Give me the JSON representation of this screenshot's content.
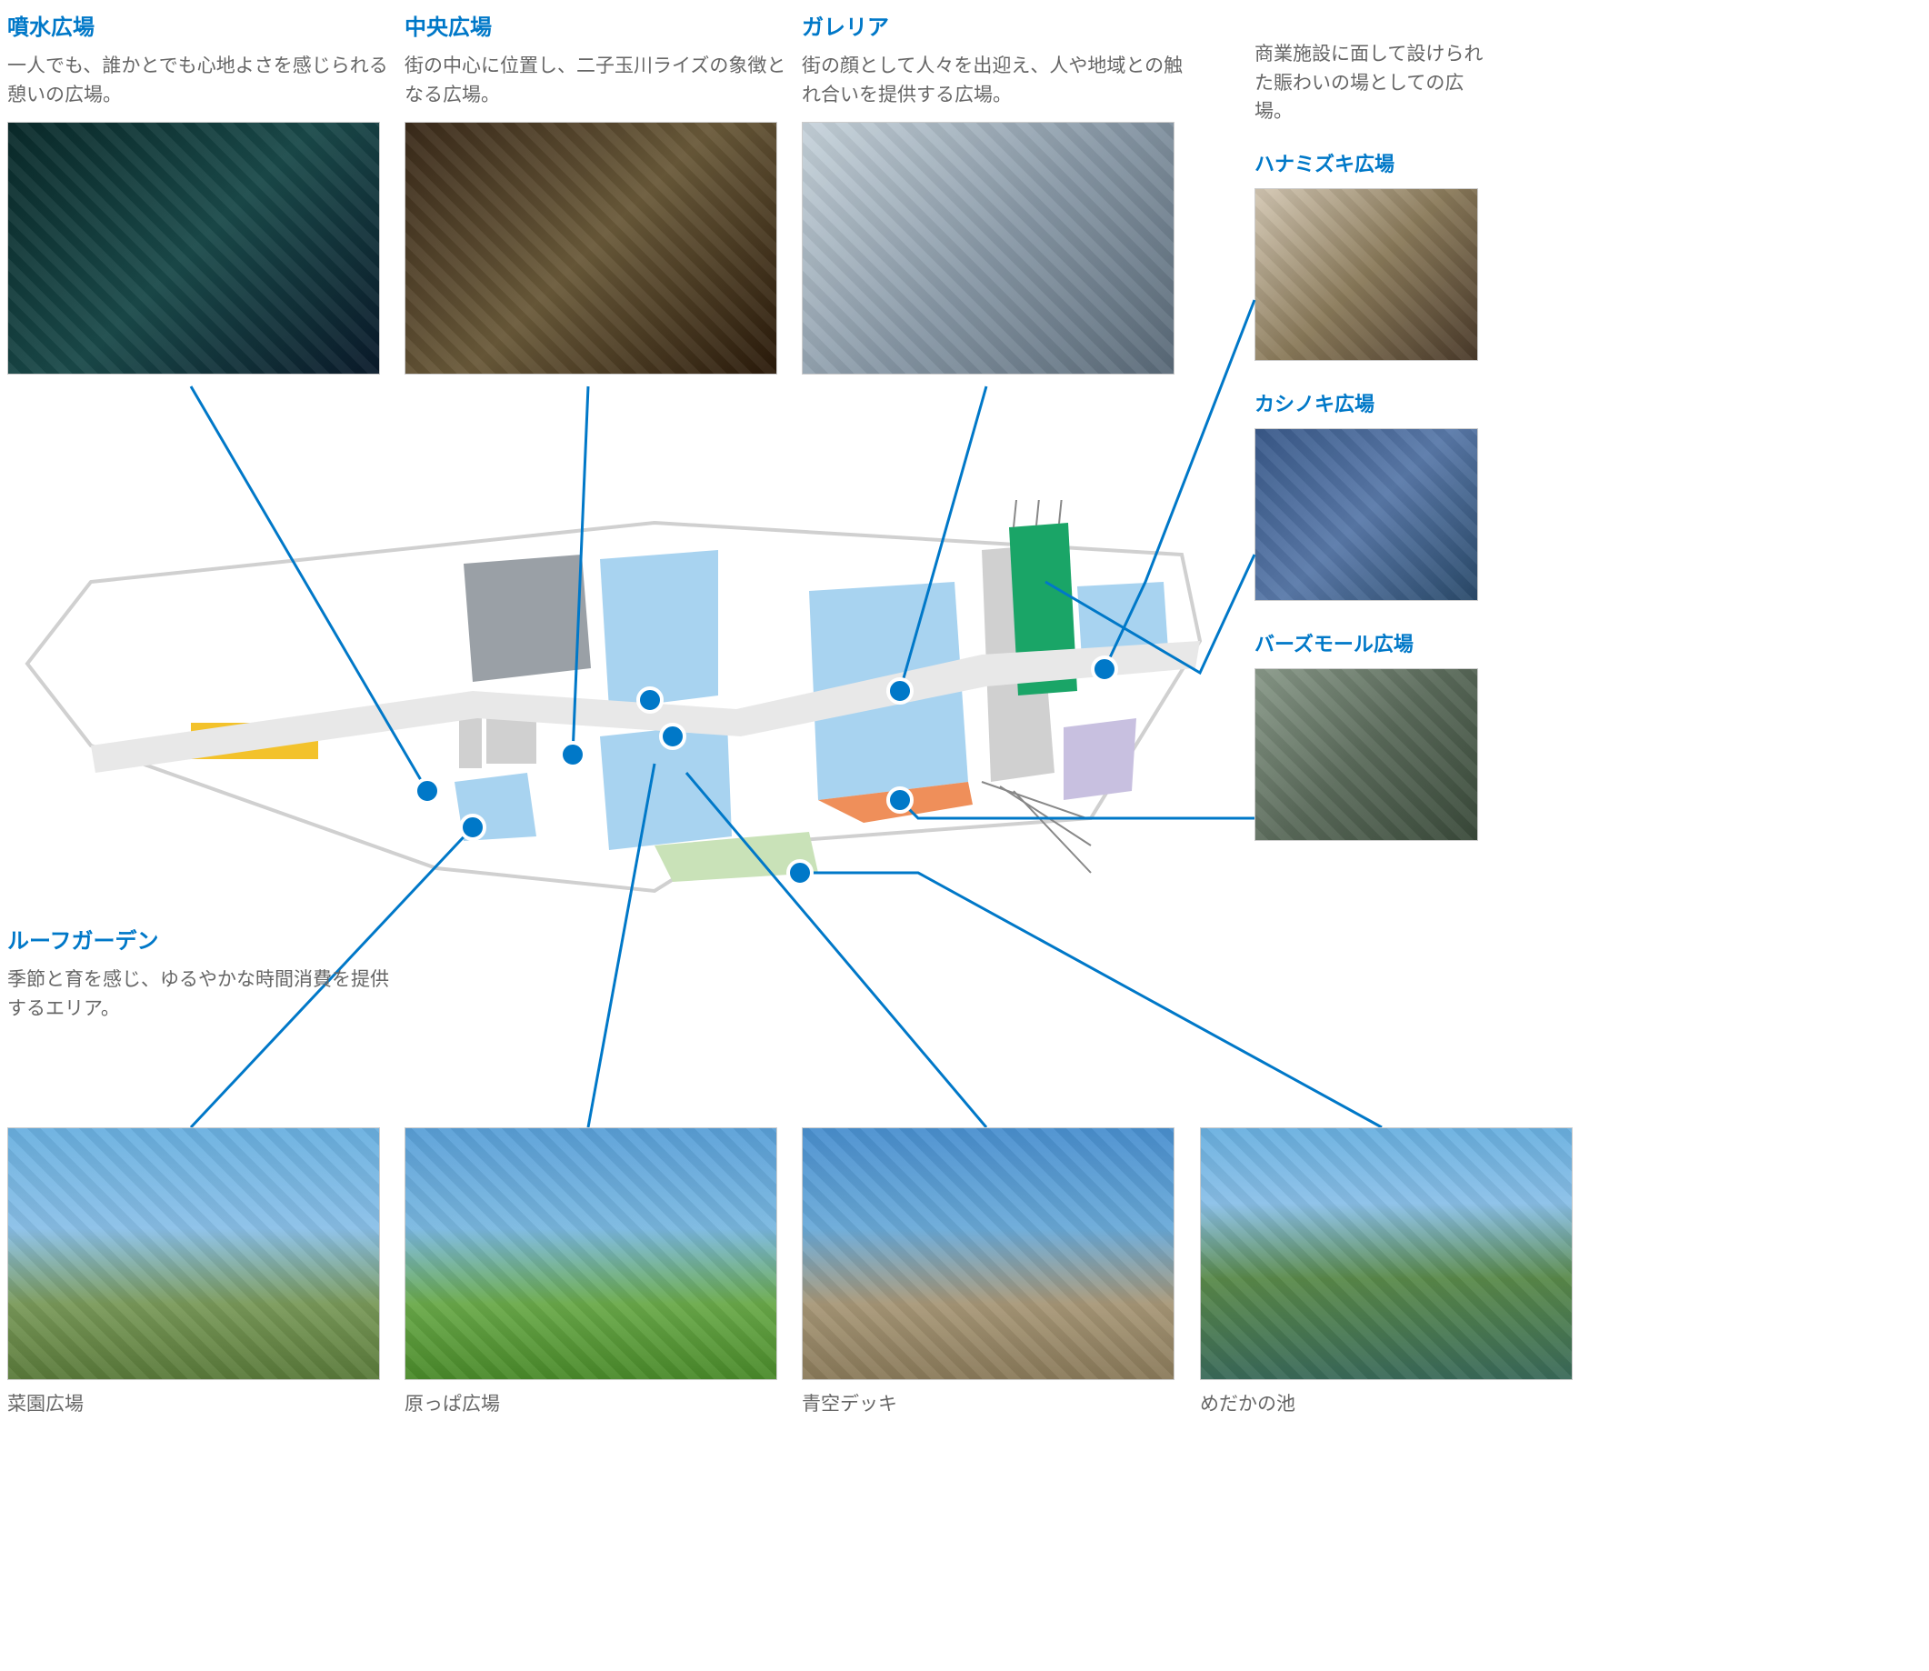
{
  "top": {
    "fountain": {
      "title": "噴水広場",
      "desc": "一人でも、誰かとでも心地よさを感じられる憩いの広場。"
    },
    "central": {
      "title": "中央広場",
      "desc": "街の中心に位置し、二子玉川ライズの象徴となる広場。"
    },
    "galleria": {
      "title": "ガレリア",
      "desc": "街の顔として人々を出迎え、人や地域との触れ合いを提供する広場。"
    }
  },
  "right": {
    "desc": "商業施設に面して設けられた賑わいの場としての広場。",
    "hanamizuki": {
      "title": "ハナミズキ広場"
    },
    "kashinoki": {
      "title": "カシノキ広場"
    },
    "birdsmall": {
      "title": "バーズモール広場"
    }
  },
  "roof": {
    "title": "ルーフガーデン",
    "desc": "季節と育を感じ、ゆるやかな時間消費を提供するエリア。"
  },
  "bottom": {
    "saien": {
      "label": "菜園広場"
    },
    "harappa": {
      "label": "原っぱ広場"
    },
    "aozora": {
      "label": "青空デッキ"
    },
    "medaka": {
      "label": "めだかの池"
    }
  }
}
